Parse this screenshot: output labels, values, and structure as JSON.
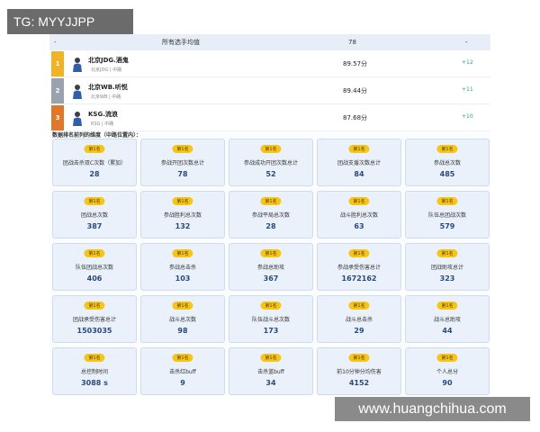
{
  "watermarks": {
    "top": "TG: MYYJJPP",
    "bottom": "www.huangchihua.com"
  },
  "summary": {
    "header": {
      "col1": "-",
      "col2": "所有选手均值",
      "col3": "78",
      "col4": "-"
    },
    "rows": [
      {
        "rank": "1",
        "name": "北京JDG.酒鬼",
        "sub": "北京JDG | 中路",
        "score": "89.57分",
        "diff": "+12",
        "color": "#f0b323"
      },
      {
        "rank": "2",
        "name": "北京WB.听悦",
        "sub": "北京WB | 中路",
        "score": "89.44分",
        "diff": "+11",
        "color": "#9aa3ad"
      },
      {
        "rank": "3",
        "name": "KSG.流浪",
        "sub": "KSG | 中路",
        "score": "87.68分",
        "diff": "+10",
        "color": "#e0772a"
      }
    ]
  },
  "section_title": "数据排名前列的维度（中路位置内）：",
  "cards": [
    {
      "badge": "第1名",
      "label": "团战击杀双C次数（累加）",
      "value": "28"
    },
    {
      "badge": "第1名",
      "label": "参战开团次数总计",
      "value": "78"
    },
    {
      "badge": "第1名",
      "label": "参战成功开团次数总计",
      "value": "52"
    },
    {
      "badge": "第1名",
      "label": "团战支援次数总计",
      "value": "84"
    },
    {
      "badge": "第1名",
      "label": "参战总次数",
      "value": "485"
    },
    {
      "badge": "第1名",
      "label": "团战总次数",
      "value": "387"
    },
    {
      "badge": "第1名",
      "label": "参战胜利总次数",
      "value": "132"
    },
    {
      "badge": "第1名",
      "label": "参战平局总次数",
      "value": "28"
    },
    {
      "badge": "第1名",
      "label": "战斗胜利总次数",
      "value": "63"
    },
    {
      "badge": "第1名",
      "label": "队伍总团战次数",
      "value": "579"
    },
    {
      "badge": "第1名",
      "label": "队伍团战总次数",
      "value": "406"
    },
    {
      "badge": "第1名",
      "label": "参战总击杀",
      "value": "103"
    },
    {
      "badge": "第1名",
      "label": "参战总助攻",
      "value": "367"
    },
    {
      "badge": "第1名",
      "label": "参战承受伤害总计",
      "value": "1672162"
    },
    {
      "badge": "第1名",
      "label": "团战助攻总计",
      "value": "323"
    },
    {
      "badge": "第1名",
      "label": "团战承受伤害总计",
      "value": "1503035"
    },
    {
      "badge": "第1名",
      "label": "战斗总次数",
      "value": "98"
    },
    {
      "badge": "第1名",
      "label": "队伍战斗总次数",
      "value": "173"
    },
    {
      "badge": "第1名",
      "label": "战斗总击杀",
      "value": "29"
    },
    {
      "badge": "第1名",
      "label": "战斗总助攻",
      "value": "44"
    },
    {
      "badge": "第1名",
      "label": "总控制时间",
      "value": "3088 s"
    },
    {
      "badge": "第1名",
      "label": "击杀红buff",
      "value": "9"
    },
    {
      "badge": "第1名",
      "label": "击杀蓝buff",
      "value": "34"
    },
    {
      "badge": "第1名",
      "label": "前10分钟分均伤害",
      "value": "4152"
    },
    {
      "badge": "第1名",
      "label": "个人总分",
      "value": "90"
    }
  ]
}
